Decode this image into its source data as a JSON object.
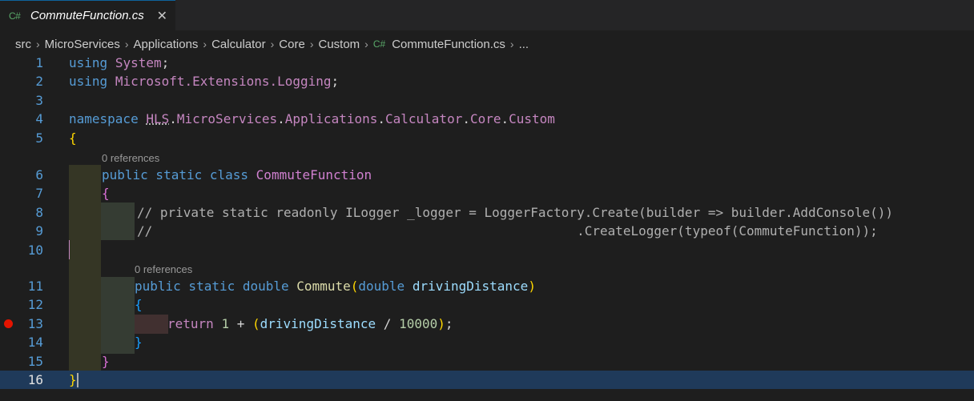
{
  "tab": {
    "language_badge": "C#",
    "filename": "CommuteFunction.cs",
    "close_glyph": "✕"
  },
  "breadcrumbs": {
    "items": [
      "src",
      "MicroServices",
      "Applications",
      "Calculator",
      "Core",
      "Custom"
    ],
    "file_badge": "C#",
    "file": "CommuteFunction.cs",
    "more": "...",
    "separator": "›"
  },
  "editor": {
    "current_line": "16",
    "breakpoint_line": "13",
    "codelens": {
      "class_refs": "0 references",
      "method_refs": "0 references"
    },
    "lines": [
      {
        "n": "1",
        "t": [
          "using",
          "System",
          ";"
        ]
      },
      {
        "n": "2",
        "t": [
          "using",
          "Microsoft.Extensions.Logging",
          ";"
        ]
      },
      {
        "n": "3",
        "t": []
      },
      {
        "n": "4",
        "t": [
          "namespace",
          "HLS",
          ".",
          "MicroServices",
          ".",
          "Applications",
          ".",
          "Calculator",
          ".",
          "Core",
          ".",
          "Custom"
        ]
      },
      {
        "n": "5",
        "t": [
          "{"
        ]
      },
      {
        "n": "6",
        "t": [
          "public static class",
          "CommuteFunction"
        ]
      },
      {
        "n": "7",
        "t": [
          "{"
        ]
      },
      {
        "n": "8",
        "t": [
          "// private static readonly ILogger _logger = LoggerFactory.Create(builder => builder.AddConsole())"
        ]
      },
      {
        "n": "9",
        "t": [
          "//                                                       .CreateLogger(typeof(CommuteFunction));"
        ]
      },
      {
        "n": "10",
        "t": []
      },
      {
        "n": "11",
        "t": [
          "public static double",
          "Commute",
          "(",
          "double",
          "drivingDistance",
          ")"
        ]
      },
      {
        "n": "12",
        "t": [
          "{"
        ]
      },
      {
        "n": "13",
        "t": [
          "return",
          "1",
          "+",
          "(",
          "drivingDistance",
          "/",
          "10000",
          ")",
          ";"
        ]
      },
      {
        "n": "14",
        "t": [
          "}"
        ]
      },
      {
        "n": "15",
        "t": [
          "}"
        ]
      },
      {
        "n": "16",
        "t": [
          "}"
        ]
      }
    ]
  }
}
